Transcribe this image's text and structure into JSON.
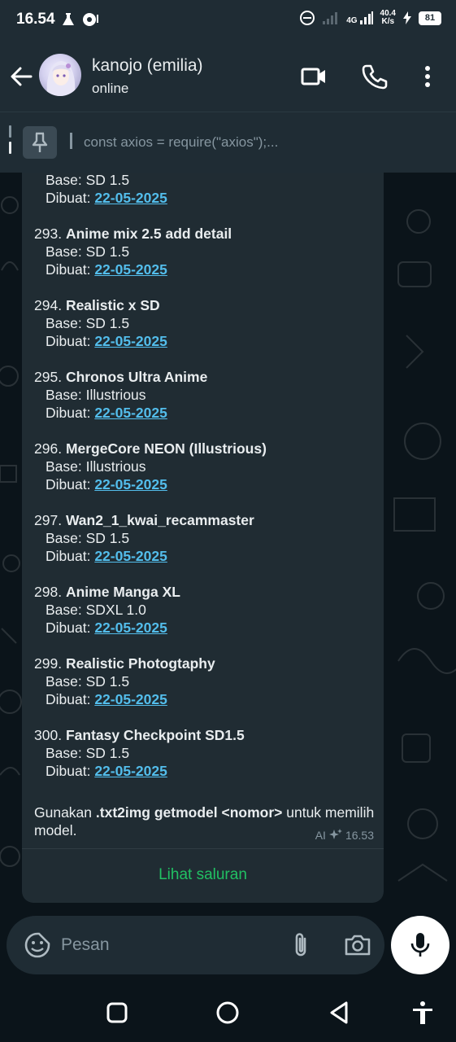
{
  "status_bar": {
    "time": "16.54",
    "network": "4G",
    "speed_value": "40.4",
    "speed_unit": "K/s",
    "battery": "81"
  },
  "header": {
    "contact_name": "kanojo (emilia)",
    "status": "online",
    "icons": [
      "back-arrow-icon",
      "video-call-icon",
      "voice-call-icon",
      "more-options-icon"
    ]
  },
  "pinned": {
    "text": "const axios = require(\"axios\");..."
  },
  "message": {
    "first_partial": {
      "base_label": "Base: ",
      "base": "SD 1.5",
      "created_label": "Dibuat: ",
      "created": "22-05-2025"
    },
    "entries": [
      {
        "number": "293. ",
        "name": "Anime mix 2.5 add detail",
        "base_label": "Base: ",
        "base": "SD 1.5",
        "created_label": "Dibuat: ",
        "created": "22-05-2025"
      },
      {
        "number": "294. ",
        "name": "Realistic x SD",
        "base_label": "Base: ",
        "base": "SD 1.5",
        "created_label": "Dibuat: ",
        "created": "22-05-2025"
      },
      {
        "number": "295. ",
        "name": "Chronos Ultra Anime",
        "base_label": "Base: ",
        "base": "Illustrious",
        "created_label": "Dibuat: ",
        "created": "22-05-2025"
      },
      {
        "number": "296. ",
        "name": "MergeCore NEON (Illustrious)",
        "base_label": "Base: ",
        "base": "Illustrious",
        "created_label": "Dibuat: ",
        "created": "22-05-2025"
      },
      {
        "number": "297. ",
        "name": "Wan2_1_kwai_recammaster",
        "base_label": "Base: ",
        "base": "SD 1.5",
        "created_label": "Dibuat: ",
        "created": "22-05-2025"
      },
      {
        "number": "298. ",
        "name": "Anime Manga XL",
        "base_label": "Base: ",
        "base": "SDXL 1.0",
        "created_label": "Dibuat: ",
        "created": "22-05-2025"
      },
      {
        "number": "299. ",
        "name": "Realistic Photogtaphy",
        "base_label": "Base: ",
        "base": "SD 1.5",
        "created_label": "Dibuat: ",
        "created": "22-05-2025"
      },
      {
        "number": "300. ",
        "name": "Fantasy Checkpoint SD1.5",
        "base_label": "Base: ",
        "base": "SD 1.5",
        "created_label": "Dibuat: ",
        "created": "22-05-2025"
      }
    ],
    "footer": {
      "prefix": "Gunakan ",
      "command": ".txt2img getmodel <nomor>",
      "suffix": " untuk memilih model."
    },
    "meta": {
      "ai_label": "AI",
      "time": "16.53"
    },
    "channel_button": "Lihat saluran"
  },
  "input": {
    "placeholder": "Pesan"
  },
  "colors": {
    "background": "#0b141a",
    "bar": "#1f2c34",
    "bubble": "#202c33",
    "link": "#53bdeb",
    "accent_green": "#21c063"
  }
}
